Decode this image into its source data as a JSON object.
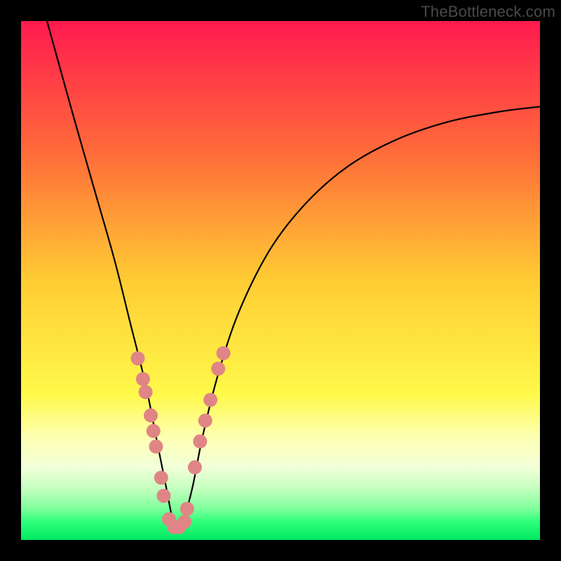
{
  "watermark": "TheBottleneck.com",
  "chart_data": {
    "type": "line",
    "title": "",
    "xlabel": "",
    "ylabel": "",
    "xlim": [
      0,
      100
    ],
    "ylim": [
      0,
      100
    ],
    "grid": false,
    "legend": false,
    "series": [
      {
        "name": "bottleneck-curve",
        "color": "#000000",
        "x": [
          5,
          10,
          14,
          18,
          21,
          24,
          26,
          28,
          29.5,
          31,
          33,
          35,
          38,
          42,
          48,
          55,
          63,
          72,
          82,
          92,
          100
        ],
        "y": [
          100,
          82,
          68,
          54,
          42,
          30,
          20,
          10,
          3,
          3,
          10,
          20,
          32,
          44,
          56,
          65,
          72,
          77,
          80.5,
          82.5,
          83.5
        ]
      }
    ],
    "markers": [
      {
        "name": "points-left-branch",
        "color": "#e08585",
        "x": [
          22.5,
          23.5,
          24.0,
          25.0,
          25.5,
          26.0,
          27.0,
          27.5
        ],
        "y": [
          35.0,
          31.0,
          28.5,
          24.0,
          21.0,
          18.0,
          12.0,
          8.5
        ]
      },
      {
        "name": "points-right-branch",
        "color": "#e08585",
        "x": [
          33.5,
          34.5,
          35.5,
          36.5,
          38.0,
          39.0
        ],
        "y": [
          14.0,
          19.0,
          23.0,
          27.0,
          33.0,
          36.0
        ]
      },
      {
        "name": "points-valley",
        "color": "#e08585",
        "x": [
          28.5,
          29.5,
          30.5,
          31.5,
          32.0
        ],
        "y": [
          4.0,
          2.5,
          2.5,
          3.5,
          6.0
        ]
      }
    ],
    "background_gradient": {
      "direction": "vertical",
      "stops": [
        {
          "pos": 0.0,
          "color": "#ff1a4f"
        },
        {
          "pos": 0.25,
          "color": "#ff6a3a"
        },
        {
          "pos": 0.5,
          "color": "#ffcc33"
        },
        {
          "pos": 0.72,
          "color": "#fff94a"
        },
        {
          "pos": 0.8,
          "color": "#fdffb0"
        },
        {
          "pos": 0.86,
          "color": "#f2ffd9"
        },
        {
          "pos": 0.9,
          "color": "#c6ffc0"
        },
        {
          "pos": 0.94,
          "color": "#7dff9c"
        },
        {
          "pos": 0.965,
          "color": "#2fff7a"
        },
        {
          "pos": 1.0,
          "color": "#00e862"
        }
      ]
    }
  }
}
